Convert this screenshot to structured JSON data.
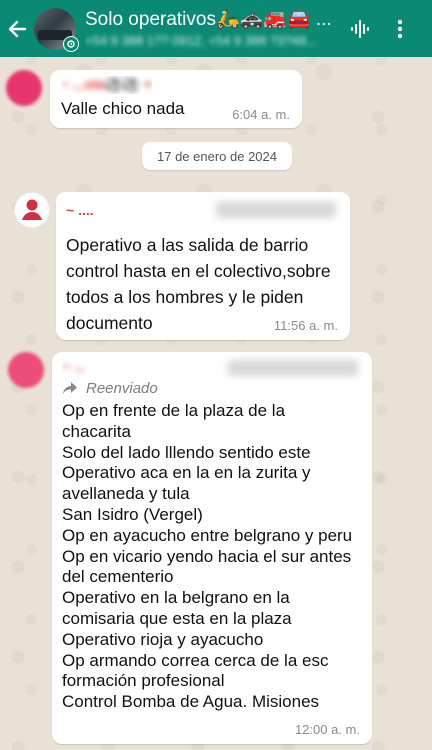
{
  "header": {
    "title": "Solo operativos🛵🚓🚒🚘 ...",
    "subtitle": "+54 9 388 1?? 0912, +54 9 388 ?3?48...",
    "colors": {
      "bar": "#0a8a74",
      "text": "#ffffff"
    }
  },
  "messages": [
    {
      "sender": "~ ...ola⚽⚽ +",
      "text": "Valle chico nada",
      "time": "6:04 a. m.",
      "avatar_color": "#e8356f"
    },
    {
      "sender": "~ ....",
      "text": "Operativo a las salida de barrio control hasta en el colectivo,sobre todos a los hombres y le piden documento",
      "time": "11:56 a. m.",
      "avatar_color": "#d32f3e"
    },
    {
      "sender": "~ ...",
      "forwarded_label": "Reenviado",
      "text": "Op en frente de la plaza de la\nchacarita\nSolo del lado lllendo sentido este\nOperativo aca en la en la zurita y\navellaneda y tula\n San Isidro (Vergel)\nOp en ayacucho entre belgrano y peru\nOp en vicario yendo hacia el sur antes\ndel cementerio\n Operativo en la belgrano en la\ncomisaria que esta en la plaza\n Operativo rioja y ayacucho\nOp armando correa cerca de la esc\nformación profesional\n Control Bomba de Agua. Misiones",
      "time": "12:00 a. m.",
      "avatar_color": "#ec4d7a"
    }
  ],
  "date_divider": "17 de enero de 2024",
  "icons": [
    "back-arrow-icon",
    "community-icon",
    "voice-wave-icon",
    "more-vert-icon",
    "forward-icon",
    "default-avatar-icon"
  ]
}
